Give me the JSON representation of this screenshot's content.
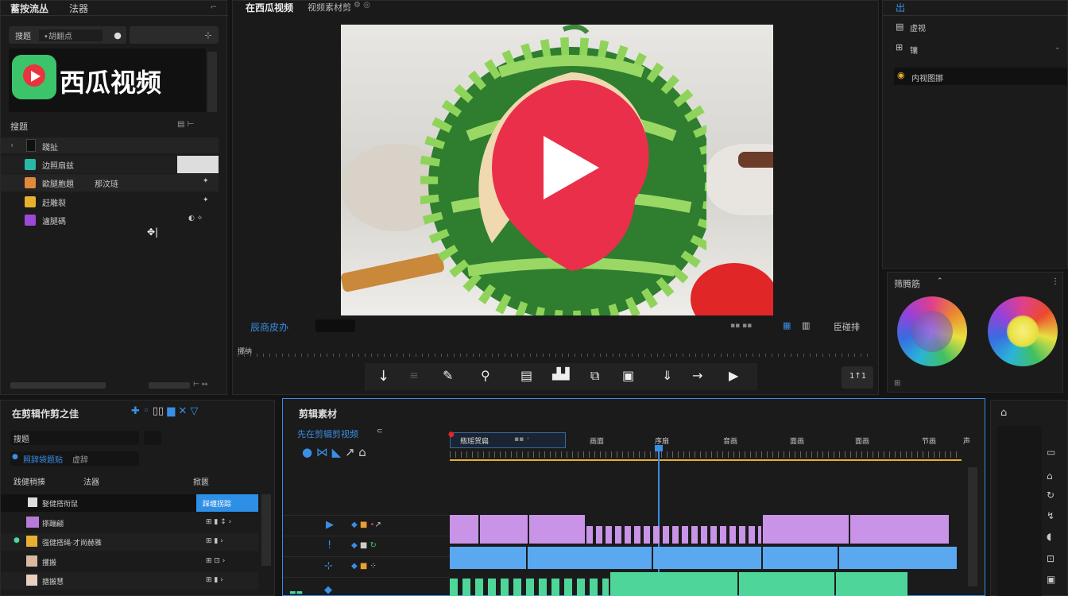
{
  "left_panel": {
    "tabs": [
      "蓄按流丛",
      "法器"
    ],
    "search_label": "搜题",
    "search_value": "•胡翻点",
    "brand_text": "西瓜视频",
    "section_title": "搜题",
    "items": [
      {
        "label": "踐扯",
        "value": ""
      },
      {
        "label": "边照扇兹",
        "value": ""
      },
      {
        "label": "歐腿胞題",
        "value": "那汶琏"
      },
      {
        "label": "赶雕裂",
        "value": ""
      },
      {
        "label": "瀘腿碼",
        "value": ""
      }
    ]
  },
  "viewer": {
    "title": "在西瓜视频",
    "subtitle": "视频素材剪",
    "timecode_label": "辰商皮办",
    "ruler_label": "挪纳",
    "right_label": "臣碰排"
  },
  "right_panel": {
    "tab": "出",
    "row1": "虚视",
    "row2": "镶",
    "row3": "内视图挪",
    "color_title": "筛腾筋"
  },
  "project_panel": {
    "title": "在剪辑作剪之佳",
    "search_value": "搜题",
    "filter_label": "照辞袋题贴",
    "filter_value": "虚辞",
    "col1": "践健稍揍",
    "col2": "法器",
    "col3": "掀匮",
    "rows": [
      {
        "label": "娶健搭衔鼠",
        "value": "踩缠拐踪"
      },
      {
        "label": "搽蹦翩",
        "value": ""
      },
      {
        "label": "强健搭绳·才尚赫雅",
        "value": ""
      },
      {
        "label": "攫搬",
        "value": ""
      },
      {
        "label": "搪搬慧",
        "value": ""
      }
    ]
  },
  "timeline": {
    "title": "剪辑素材",
    "sequence": "先在剪辑剪视频",
    "clip_label": "瓶瑶贺扁",
    "markers": [
      "画面",
      "序扇",
      "音画",
      "面画",
      "面画",
      "节画",
      "声"
    ]
  },
  "colors": {
    "accent": "#3a8ee6",
    "purple_track": "#c993e8",
    "blue_track": "#5aa8f0",
    "green_track": "#4ed69a",
    "brand_red": "#e8343f",
    "brand_green": "#3cc46a"
  },
  "icons": [
    "search-icon",
    "play-icon",
    "download-icon",
    "settings-icon",
    "gear-icon"
  ]
}
